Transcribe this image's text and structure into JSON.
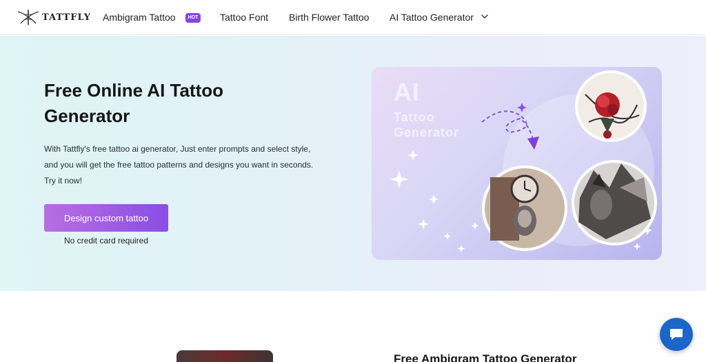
{
  "brand": {
    "name": "TATTFLY"
  },
  "nav": {
    "items": [
      {
        "label": "Ambigram Tattoo",
        "badge": "HOT"
      },
      {
        "label": "Tattoo Font"
      },
      {
        "label": "Birth Flower Tattoo"
      },
      {
        "label": "AI Tattoo Generator",
        "icon": "chevron-down-icon"
      }
    ]
  },
  "hero": {
    "title": "Free Online AI Tattoo Generator",
    "description": "With Tattfly's free tattoo ai generator, Just enter prompts and select style, and you will get the free tattoo patterns and designs you want in seconds. Try it now!",
    "cta_label": "Design custom tattoo",
    "cta_note": "No credit card required",
    "image": {
      "headline": "AI",
      "subline_1": "Tattoo",
      "subline_2": "Generator"
    }
  },
  "section2": {
    "title": "Free Ambigram Tattoo Generator"
  },
  "colors": {
    "accent": "#8a45e0",
    "cta_start": "#b86ee2",
    "cta_end": "#8a4ee4",
    "chat": "#1b66c9"
  }
}
